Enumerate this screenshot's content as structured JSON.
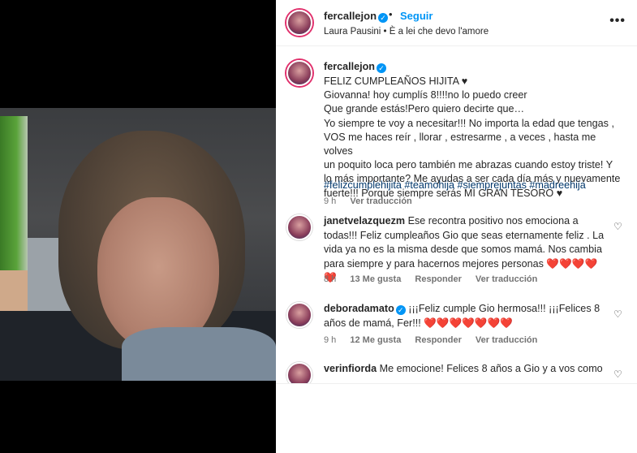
{
  "post": {
    "username": "fercallejon",
    "follow_label": "Seguir",
    "separator": "•",
    "song": "Laura Pausini • È a lei che devo l'amore",
    "more": "•••"
  },
  "caption": {
    "username": "fercallejon",
    "text": "FELIZ CUMPLEAÑOS HIJITA ♥\nGiovanna! hoy cumplís 8!!!!no lo puedo creer\nQue grande estás!Pero quiero decirte que…\nYo siempre te voy a necesitar!!! No importa la edad que tengas ,\nVOS me haces reír , llorar , estresarme , a veces , hasta me volves\nun poquito loca pero también me abrazas cuando estoy triste! Y\nlo más importante? Me ayudas a ser cada día más y nuevamente\nfuerte!!! Porque siempre serás MI GRAN TESORO ♥",
    "hashtags": "#felizcumplehijita #teamohija #siemprejuntas #madreehija",
    "time": "9 h",
    "translate": "Ver traducción"
  },
  "comments": [
    {
      "username": "janetvelazquezm",
      "text": "Ese recontra positivo nos emociona a todas!!! Feliz cumpleaños Gio que seas eternamente feliz . La vida ya no es la misma desde que somos mamá. Nos cambia para siempre y para hacernos mejores personas ",
      "hearts": "❤️❤️❤️❤️❤️",
      "time": "8 h",
      "likes": "13 Me gusta",
      "reply": "Responder",
      "translate": "Ver traducción"
    },
    {
      "username": "deboradamato",
      "text": "¡¡¡Feliz cumple Gio hermosa!!! ¡¡¡Felices 8 años de mamá, Fer!!! ",
      "hearts": "❤️❤️❤️❤️❤️❤️❤️",
      "time": "9 h",
      "likes": "12 Me gusta",
      "reply": "Responder",
      "translate": "Ver traducción"
    },
    {
      "username": "verinfiorda",
      "text": "Me emocione! Felices 8 años a Gio y a vos como"
    }
  ]
}
